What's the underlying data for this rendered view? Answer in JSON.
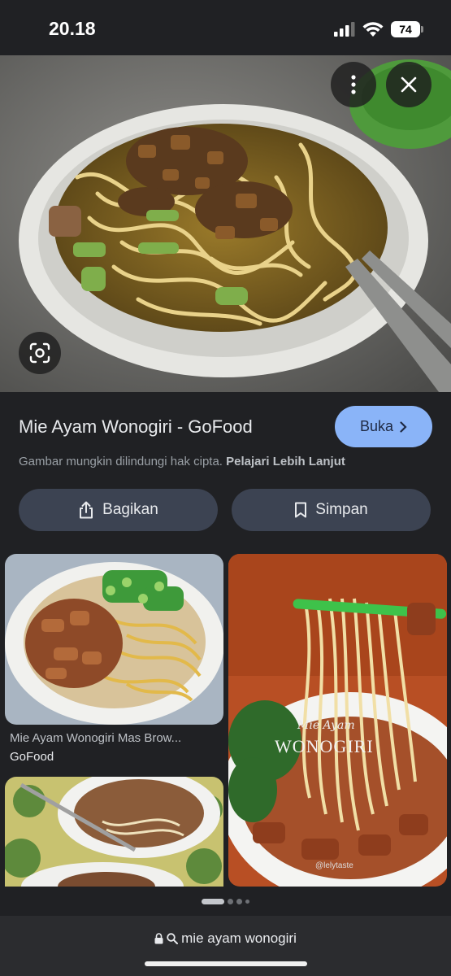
{
  "status_bar": {
    "time": "20.18",
    "battery": "74"
  },
  "hero": {
    "more_icon": "more-vert-icon",
    "close_icon": "close-icon",
    "lens_icon": "google-lens-icon"
  },
  "result": {
    "title": "Mie Ayam Wonogiri - GoFood",
    "open_label": "Buka",
    "copyright_text": "Gambar mungkin dilindungi hak cipta.",
    "learn_more": "Pelajari Lebih Lanjut",
    "share_label": "Bagikan",
    "save_label": "Simpan",
    "accent_color": "#8ab4f8"
  },
  "related": {
    "items": [
      {
        "title": "Mie Ayam Wonogiri Mas Brow...",
        "source": "GoFood"
      }
    ],
    "overlay_script": "Mie Ayam",
    "overlay_word": "WONOGIRI",
    "overlay_handle": "@lelytaste"
  },
  "browser": {
    "url": "mie ayam wonogiri"
  }
}
